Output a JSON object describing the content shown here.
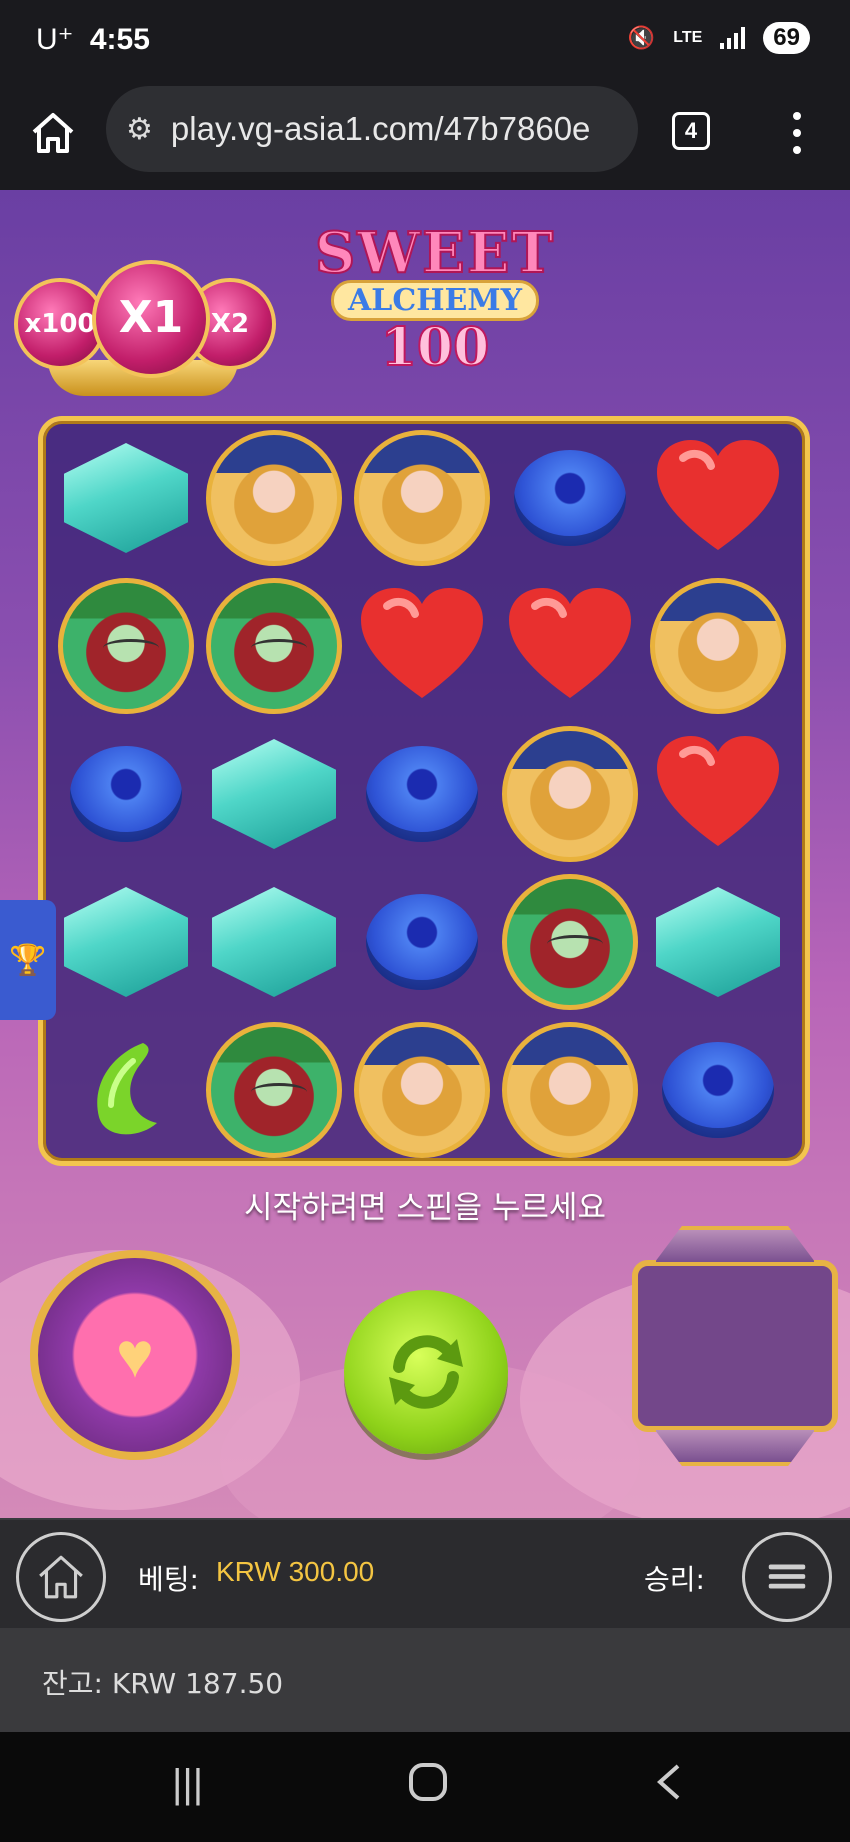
{
  "status": {
    "carrier": "U⁺",
    "time": "4:55",
    "network": "LTE",
    "battery": "69"
  },
  "browser": {
    "url": "play.vg-asia1.com/47b7860e",
    "tab_count": "4"
  },
  "game": {
    "logo": {
      "line1": "SWEET",
      "line2": "ALCHEMY",
      "line3": "100"
    },
    "multipliers": {
      "left": "x100",
      "current": "X1",
      "right": "X2"
    },
    "grid": [
      [
        "gem",
        "blonde-witch",
        "blonde-witch",
        "donut",
        "heart"
      ],
      [
        "redhead-witch",
        "redhead-witch",
        "heart",
        "heart",
        "blonde-witch"
      ],
      [
        "donut",
        "gem",
        "donut",
        "blonde-witch",
        "heart"
      ],
      [
        "gem",
        "gem",
        "donut",
        "redhead-witch",
        "gem"
      ],
      [
        "bean",
        "redhead-witch",
        "blonde-witch",
        "blonde-witch",
        "donut"
      ]
    ],
    "hint": "시작하려면 스핀을 누르세요",
    "colors": {
      "accent_gold": "#f3c54e",
      "spin_green": "#8fd21a",
      "bet_yellow": "#f4c542"
    }
  },
  "controls": {
    "bet_label": "베팅:",
    "bet_value": "KRW 300.00",
    "win_label": "승리:",
    "balance": "잔고: KRW 187.50"
  }
}
